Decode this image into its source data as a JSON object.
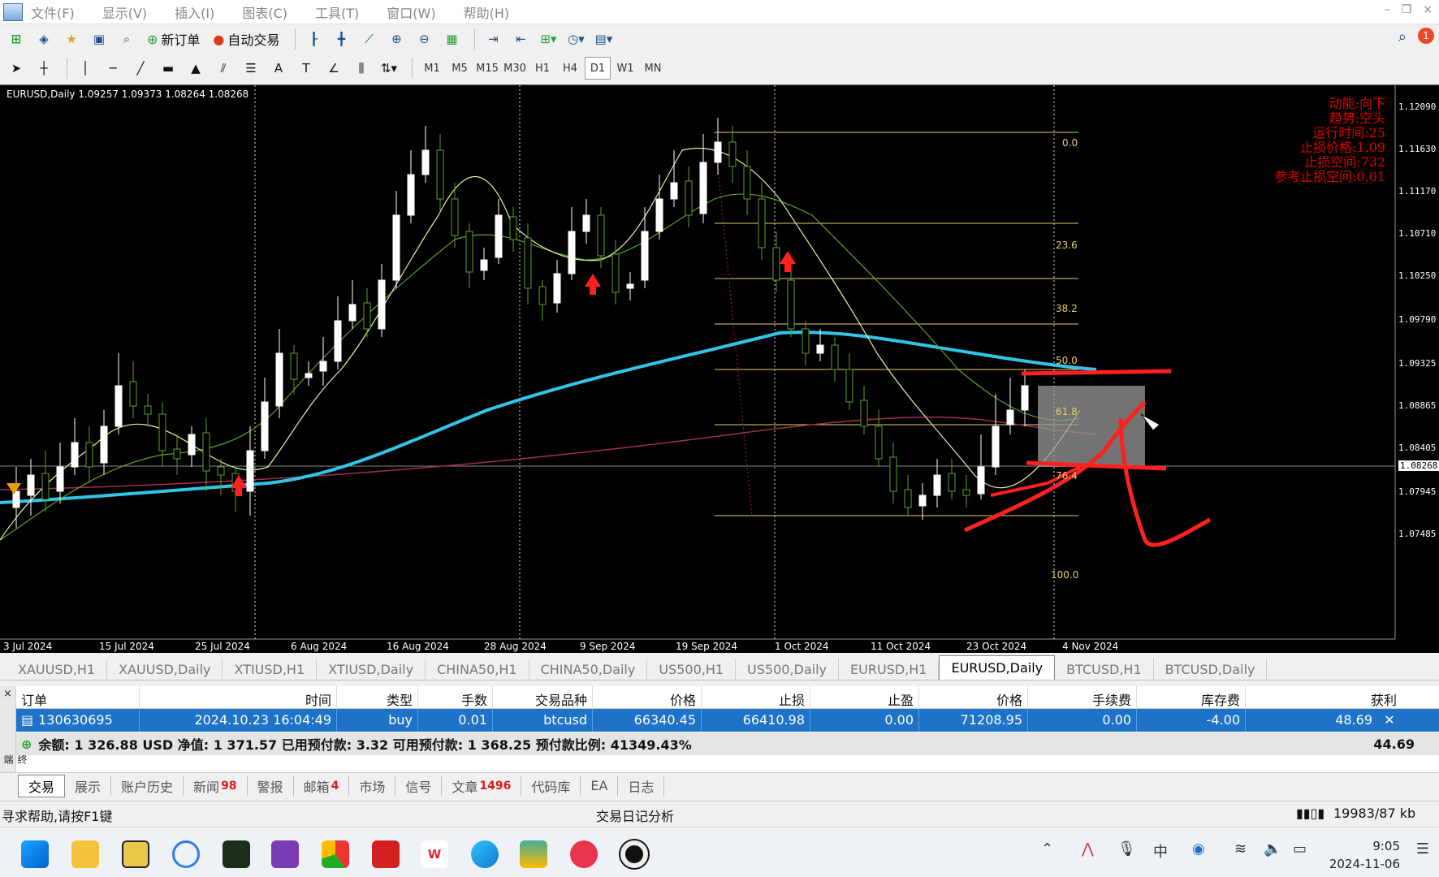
{
  "menu": [
    "文件(F)",
    "显示(V)",
    "插入(I)",
    "图表(C)",
    "工具(T)",
    "窗口(W)",
    "帮助(H)"
  ],
  "toolbar": {
    "new_order": "新订单",
    "auto_trade": "自动交易",
    "timeframes": [
      "M1",
      "M5",
      "M15",
      "M30",
      "H1",
      "H4",
      "D1",
      "W1",
      "MN"
    ],
    "active_timeframe": "D1"
  },
  "chart": {
    "symbol_line": "EURUSD,Daily  1.09257 1.09373 1.08264 1.08268",
    "info_lines": [
      "动能:向下",
      "趋势:空头",
      "运行时间:25",
      "止损价格:1.09",
      "止损空间:732",
      "参考止损空间:0.01"
    ],
    "y_labels": [
      "1.12090",
      "1.11630",
      "1.11170",
      "1.10710",
      "1.10250",
      "1.09790",
      "1.09325",
      "1.08865",
      "1.08405",
      "1.07945",
      "1.07485"
    ],
    "current_price": "1.08268",
    "x_labels": [
      "3 Jul 2024",
      "15 Jul 2024",
      "25 Jul 2024",
      "6 Aug 2024",
      "16 Aug 2024",
      "28 Aug 2024",
      "9 Sep 2024",
      "19 Sep 2024",
      "1 Oct 2024",
      "11 Oct 2024",
      "23 Oct 2024",
      "4 Nov 2024"
    ],
    "fib_levels": [
      "0.0",
      "23.6",
      "38.2",
      "50.0",
      "61.8",
      "76.4",
      "100.0"
    ],
    "colors": {
      "background": "#000000",
      "bull_candle": "#ffffff",
      "grid": "#ffffff",
      "ma_fast": "#e8f0a0",
      "ma_mid": "#5aa02c",
      "ma_slow": "#33c4e8",
      "ma_long": "#a0304a",
      "annotation": "#ff2020",
      "fib": "#e6cf6a"
    }
  },
  "chart_tabs": [
    "XAUUSD,H1",
    "XAUUSD,Daily",
    "XTIUSD,H1",
    "XTIUSD,Daily",
    "CHINA50,H1",
    "CHINA50,Daily",
    "US500,H1",
    "US500,Daily",
    "EURUSD,H1",
    "EURUSD,Daily",
    "BTCUSD,H1",
    "BTCUSD,Daily"
  ],
  "active_chart_tab": "EURUSD,Daily",
  "terminal": {
    "columns": [
      "订单",
      "时间",
      "类型",
      "手数",
      "交易品种",
      "价格",
      "止损",
      "止盈",
      "价格",
      "手续费",
      "库存费",
      "获利"
    ],
    "row": [
      "130630695",
      "2024.10.23 16:04:49",
      "buy",
      "0.01",
      "btcusd",
      "66340.45",
      "66410.98",
      "0.00",
      "71208.95",
      "0.00",
      "-4.00",
      "48.69"
    ],
    "balance_line": "余额: 1 326.88 USD  净值: 1 371.57  已用预付款: 3.32  可用预付款: 1 368.25  预付款比例: 41349.43%",
    "balance_profit": "44.69",
    "side_label": "终端"
  },
  "bottom_tabs": [
    {
      "label": "交易",
      "count": ""
    },
    {
      "label": "展示",
      "count": ""
    },
    {
      "label": "账户历史",
      "count": ""
    },
    {
      "label": "新闻",
      "count": "98"
    },
    {
      "label": "警报",
      "count": ""
    },
    {
      "label": "邮箱",
      "count": "4"
    },
    {
      "label": "市场",
      "count": ""
    },
    {
      "label": "信号",
      "count": ""
    },
    {
      "label": "文章",
      "count": "1496"
    },
    {
      "label": "代码库",
      "count": ""
    },
    {
      "label": "EA",
      "count": ""
    },
    {
      "label": "日志",
      "count": ""
    }
  ],
  "status": {
    "help": "寻求帮助,请按F1键",
    "journal": "交易日记分析",
    "traffic": "19983/87 kb"
  },
  "taskbar": {
    "time": "9:05",
    "date": "2024-11-06",
    "ime": "中"
  }
}
